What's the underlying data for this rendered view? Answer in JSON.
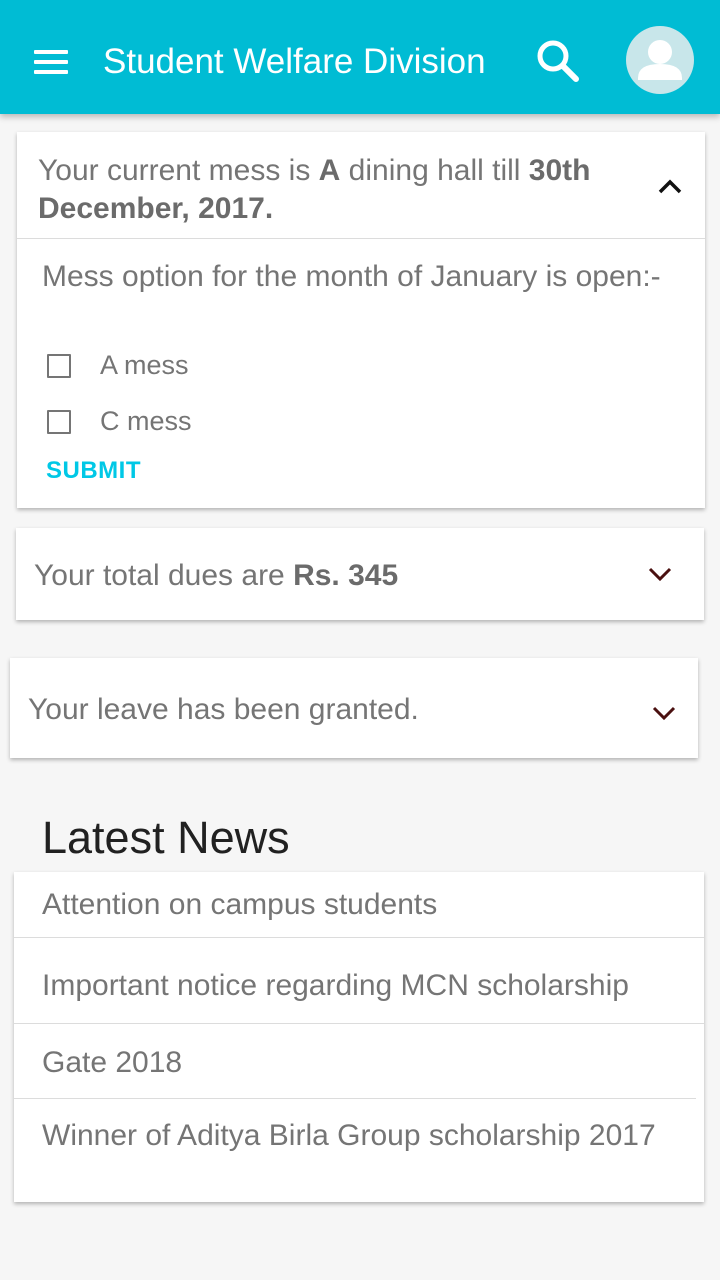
{
  "appbar": {
    "title": "Student Welfare Division",
    "menu_icon": "menu-icon",
    "search_icon": "search-icon",
    "avatar_icon": "account-avatar-icon",
    "color": "#00bcd4"
  },
  "mess_card": {
    "header_prefix": "Your current mess is ",
    "mess_name": "A",
    "header_middle": " dining hall till ",
    "valid_till": "30th December, 2017.",
    "chevron": "chevron-up-icon",
    "body_text": "Mess option for the month of January is open:-",
    "options": [
      {
        "label": "A mess",
        "checked": false
      },
      {
        "label": "C mess",
        "checked": false
      }
    ],
    "submit_label": "SUBMIT",
    "submit_color": "#00c8e6"
  },
  "dues_card": {
    "prefix": "Your total dues are ",
    "amount": "Rs. 345",
    "chevron": "chevron-down-icon"
  },
  "leave_card": {
    "text": "Your leave has been granted.",
    "chevron": "chevron-down-icon"
  },
  "news": {
    "heading": "Latest News",
    "items": [
      "Attention on campus students",
      "Important notice regarding MCN scholarship",
      "Gate 2018",
      "Winner of Aditya Birla Group scholarship 2017"
    ]
  }
}
